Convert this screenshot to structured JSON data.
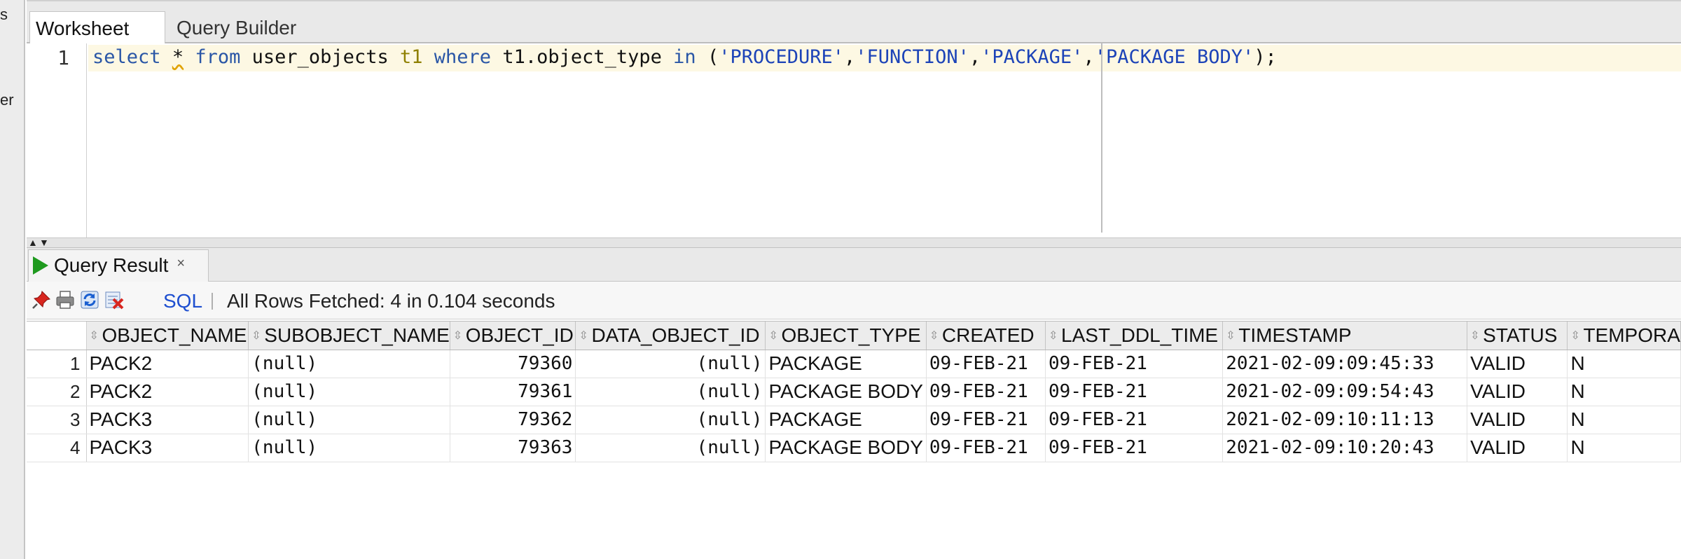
{
  "left_panel": {
    "fragments": [
      "s",
      "er"
    ]
  },
  "tabs": [
    {
      "label": "Worksheet",
      "active": true
    },
    {
      "label": "Query Builder",
      "active": false
    }
  ],
  "editor": {
    "line_number": "1",
    "tokens": {
      "t01": "select",
      "t02": "*",
      "t03": "from",
      "t04": "user_objects",
      "t05": "t1",
      "t06": "where",
      "t07": "t1.object_type",
      "t08": "in",
      "t09": "(",
      "t10": "'PROCEDURE'",
      "t11": ",",
      "t12": "'FUNCTION'",
      "t13": ",",
      "t14": "'PACKAGE'",
      "t15": ",",
      "t16": "'PACKAGE BODY'",
      "t17": ");"
    }
  },
  "result_panel": {
    "tab_label": "Query Result",
    "close_symbol": "×",
    "toolbar": {
      "sql_label": "SQL",
      "status_text": "All Rows Fetched: 4 in 0.104 seconds"
    },
    "columns": [
      "OBJECT_NAME",
      "SUBOBJECT_NAME",
      "OBJECT_ID",
      "DATA_OBJECT_ID",
      "OBJECT_TYPE",
      "CREATED",
      "LAST_DDL_TIME",
      "TIMESTAMP",
      "STATUS",
      "TEMPORA"
    ],
    "rows": [
      {
        "n": "1",
        "cells": [
          "PACK2",
          "(null)",
          "79360",
          "(null)",
          "PACKAGE",
          "09-FEB-21",
          "09-FEB-21",
          "2021-02-09:09:45:33",
          "VALID",
          "N"
        ]
      },
      {
        "n": "2",
        "cells": [
          "PACK2",
          "(null)",
          "79361",
          "(null)",
          "PACKAGE BODY",
          "09-FEB-21",
          "09-FEB-21",
          "2021-02-09:09:54:43",
          "VALID",
          "N"
        ]
      },
      {
        "n": "3",
        "cells": [
          "PACK3",
          "(null)",
          "79362",
          "(null)",
          "PACKAGE",
          "09-FEB-21",
          "09-FEB-21",
          "2021-02-09:10:11:13",
          "VALID",
          "N"
        ]
      },
      {
        "n": "4",
        "cells": [
          "PACK3",
          "(null)",
          "79363",
          "(null)",
          "PACKAGE BODY",
          "09-FEB-21",
          "09-FEB-21",
          "2021-02-09:10:20:43",
          "VALID",
          "N"
        ]
      }
    ]
  },
  "icons": [
    "pin-icon",
    "print-icon",
    "refresh-icon",
    "delete-icon",
    "play-icon",
    "sort-icon",
    "close-icon"
  ],
  "colors": {
    "keyword": "#2a56a6",
    "alias": "#8f8000",
    "string": "#1d44b8",
    "sql_link": "#1e4fd0",
    "run_green": "#1f9a1f"
  }
}
